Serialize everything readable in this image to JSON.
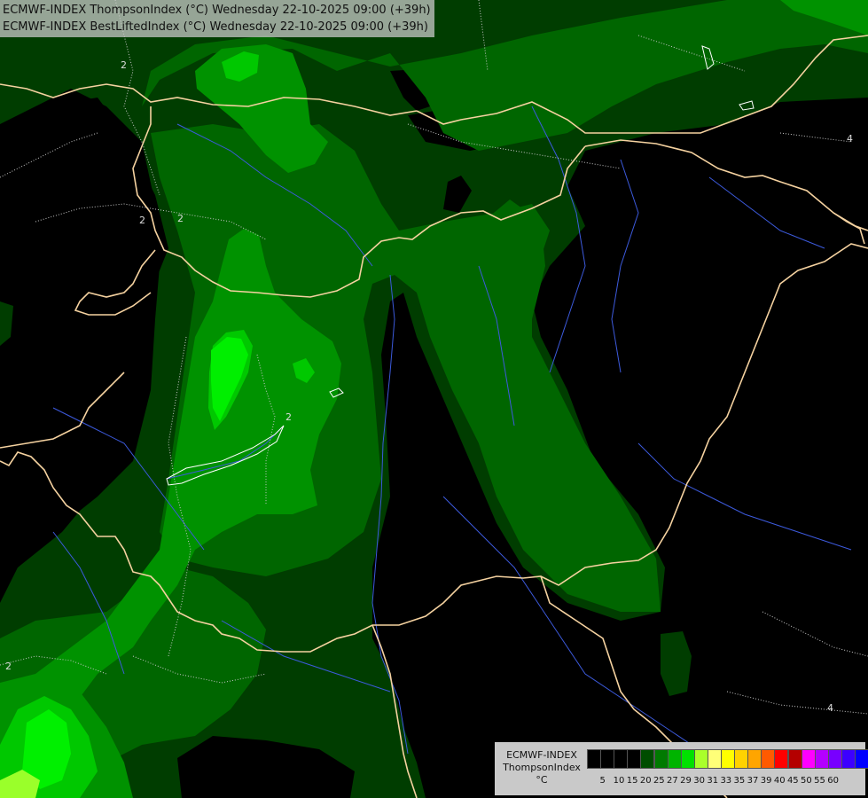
{
  "title": {
    "line1": "ECMWF-INDEX ThompsonIndex (°C) Wednesday 22-10-2025 09:00 (+39h)",
    "line2": "ECMWF-INDEX BestLiftedIndex (°C) Wednesday 22-10-2025 09:00 (+39h)"
  },
  "contour_labels": [
    "2",
    "2",
    "2",
    "2",
    "4",
    "4",
    "2"
  ],
  "legend": {
    "title_line1": "ECMWF-INDEX",
    "title_line2": "ThompsonIndex",
    "unit": "°C",
    "ticks": [
      "5",
      "10",
      "15",
      "20",
      "25",
      "27",
      "29",
      "30",
      "31",
      "33",
      "35",
      "37",
      "39",
      "40",
      "45",
      "50",
      "55",
      "60"
    ],
    "colors": [
      "#000000",
      "#000000",
      "#000000",
      "#000000",
      "#004d00",
      "#007a00",
      "#00b400",
      "#00e100",
      "#aaff2a",
      "#ffff78",
      "#ffff00",
      "#ffd200",
      "#ffa500",
      "#ff5a00",
      "#ff0000",
      "#b40000",
      "#ff00ff",
      "#b400ff",
      "#7800ff",
      "#3c00ff",
      "#0000ff"
    ]
  },
  "colors": {
    "l20": "#003d00",
    "l25": "#006600",
    "l27": "#009200",
    "l29": "#00c800",
    "l30": "#00f000",
    "l31": "#9aff2a",
    "border": "#f5d2a0",
    "river": "#3c5adc",
    "contour": "#c8c8c8"
  }
}
